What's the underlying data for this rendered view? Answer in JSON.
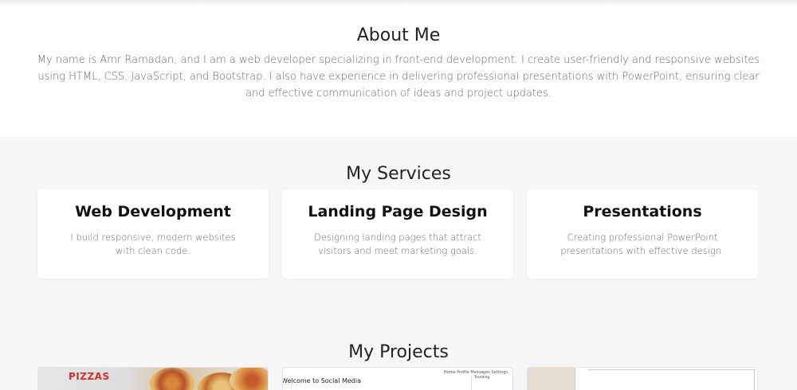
{
  "about": {
    "title": "About Me",
    "text": "My name is Amr Ramadan, and I am a web developer specializing in front-end development. I create user-friendly and responsive websites using HTML, CSS, JavaScript, and Bootstrap. I also have experience in delivering professional presentations with PowerPoint, ensuring clear and effective communication of ideas and project updates."
  },
  "services": {
    "title": "My Services",
    "items": [
      {
        "title": "Web Development",
        "text": "I build responsive, modern websites with clean code."
      },
      {
        "title": "Landing Page Design",
        "text": "Designing landing pages that attract visitors and meet marketing goals."
      },
      {
        "title": "Presentations",
        "text": "Creating professional PowerPoint presentations with effective design."
      }
    ]
  },
  "projects": {
    "title": "My Projects",
    "thumbs": {
      "pizza_brand": "PIZZAS",
      "social_nav": "Home Profile Messages Settings",
      "social_welcome": "Welcome to Social Media",
      "social_trending": "Trending"
    }
  },
  "colors": {
    "accent_red": "#d32f2f",
    "section_bg": "#f7f7f9"
  }
}
